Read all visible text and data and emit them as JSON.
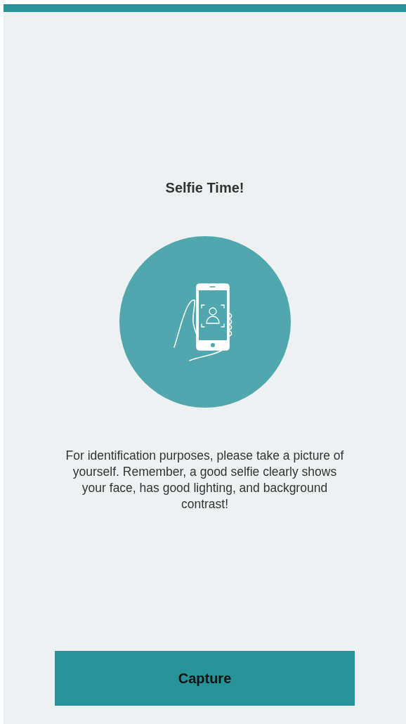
{
  "header": {
    "title": "Selfie Time!"
  },
  "instructions": "For identification purposes, please take a picture of yourself. Remember, a good selfie clearly shows your face, has good lighting, and background contrast!",
  "buttons": [
    {
      "label": "Capture"
    }
  ]
}
